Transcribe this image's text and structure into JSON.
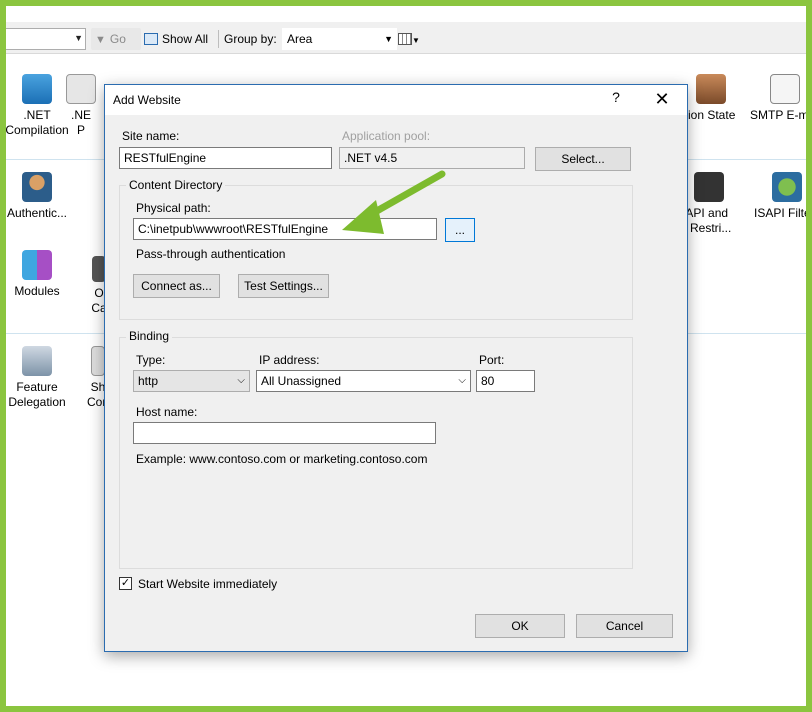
{
  "toolbar": {
    "go_label": "Go",
    "show_all_label": "Show All",
    "group_by_label": "Group by:",
    "group_by_value": "Area"
  },
  "features": {
    "net_compilation": ".NET\nCompilation",
    "net_partial": ".NE\nP",
    "session_state": "ssion State",
    "smtp_email": "SMTP E-m",
    "authentication": "Authentic...",
    "isapi_cgi": "ISAPI and\nGI Restri...",
    "isapi_filters": "ISAPI Filte",
    "modules": "Modules",
    "output_caching_partial": "O\nCa",
    "feature_delegation": "Feature\nDelegation",
    "shared_config_partial": "Sh\nCon"
  },
  "dialog": {
    "title": "Add Website",
    "help": "?",
    "close": "✕",
    "site_name_label": "Site name:",
    "site_name_value": "RESTfulEngine",
    "app_pool_label": "Application pool:",
    "app_pool_value": ".NET v4.5",
    "select_button": "Select...",
    "content_directory_label": "Content Directory",
    "physical_path_label": "Physical path:",
    "physical_path_value": "C:\\inetpub\\wwwroot\\RESTfulEngine",
    "browse_button": "...",
    "pass_through_label": "Pass-through authentication",
    "connect_as_button": "Connect as...",
    "test_settings_button": "Test Settings...",
    "binding_label": "Binding",
    "type_label": "Type:",
    "type_value": "http",
    "ip_label": "IP address:",
    "ip_value": "All Unassigned",
    "port_label": "Port:",
    "port_value": "80",
    "host_name_label": "Host name:",
    "host_name_value": "",
    "example_text": "Example: www.contoso.com or marketing.contoso.com",
    "start_immediately_label": "Start Website immediately",
    "start_immediately_checked": "✓",
    "ok_button": "OK",
    "cancel_button": "Cancel"
  },
  "colors": {
    "annotation_arrow": "#7dbb2e",
    "frame": "#8bc53f",
    "accent": "#0078d7"
  }
}
